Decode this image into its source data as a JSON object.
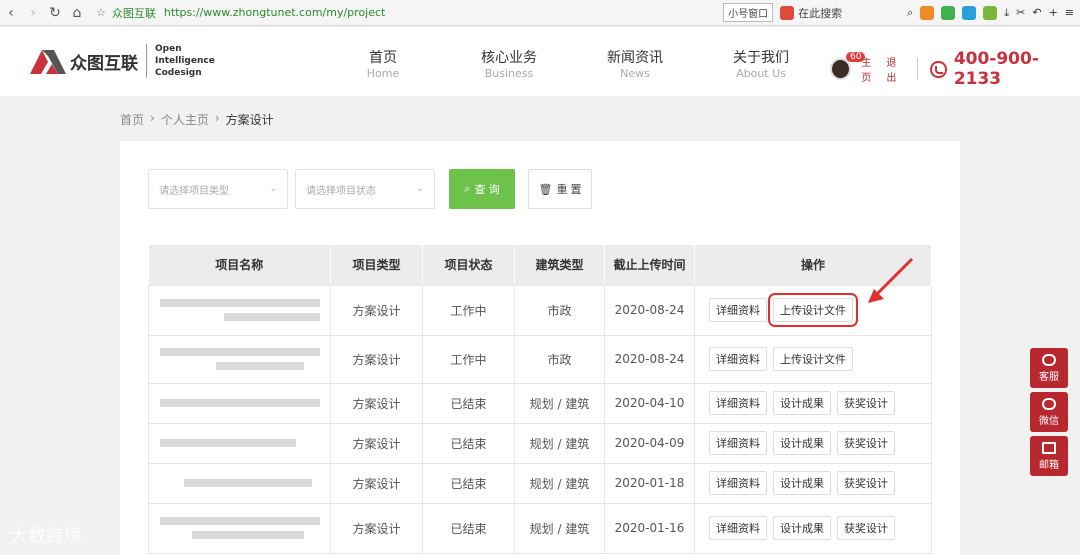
{
  "browser": {
    "site_name": "众图互联",
    "url": "https://www.zhongtunet.com/my/project",
    "small_window": "小号窗口",
    "search_placeholder": "在此搜索"
  },
  "header": {
    "logo_cn": "众图互联",
    "logo_en_1": "Open",
    "logo_en_2": "Intelligence",
    "logo_en_3": "Codesign",
    "nav": [
      {
        "cn": "首页",
        "en": "Home"
      },
      {
        "cn": "核心业务",
        "en": "Business"
      },
      {
        "cn": "新闻资讯",
        "en": "News"
      },
      {
        "cn": "关于我们",
        "en": "About Us"
      }
    ],
    "badge_count": "60",
    "home_link": "主页",
    "logout_link": "退出",
    "phone": "400-900-2133"
  },
  "breadcrumb": {
    "home": "首页",
    "personal": "个人主页",
    "current": "方案设计"
  },
  "filters": {
    "type_placeholder": "请选择项目类型",
    "status_placeholder": "请选择项目状态",
    "search_label": "查 询",
    "reset_label": "重 置"
  },
  "table": {
    "headers": [
      "项目名称",
      "项目类型",
      "项目状态",
      "建筑类型",
      "截止上传时间",
      "操作"
    ],
    "rows": [
      {
        "type": "方案设计",
        "status": "工作中",
        "building": "市政",
        "deadline": "2020-08-24",
        "ops": [
          "详细资料",
          "上传设计文件"
        ]
      },
      {
        "type": "方案设计",
        "status": "工作中",
        "building": "市政",
        "deadline": "2020-08-24",
        "ops": [
          "详细资料",
          "上传设计文件"
        ]
      },
      {
        "type": "方案设计",
        "status": "已结束",
        "building": "规划 / 建筑",
        "deadline": "2020-04-10",
        "ops": [
          "详细资料",
          "设计成果",
          "获奖设计"
        ]
      },
      {
        "type": "方案设计",
        "status": "已结束",
        "building": "规划 / 建筑",
        "deadline": "2020-04-09",
        "ops": [
          "详细资料",
          "设计成果",
          "获奖设计"
        ]
      },
      {
        "type": "方案设计",
        "status": "已结束",
        "building": "规划 / 建筑",
        "deadline": "2020-01-18",
        "ops": [
          "详细资料",
          "设计成果",
          "获奖设计"
        ]
      },
      {
        "type": "方案设计",
        "status": "已结束",
        "building": "规划 / 建筑",
        "deadline": "2020-01-16",
        "ops": [
          "详细资料",
          "设计成果",
          "获奖设计"
        ]
      }
    ]
  },
  "side": {
    "service": "客服",
    "wechat": "微信",
    "mail": "邮箱"
  },
  "watermark": "大数跨境",
  "colors": {
    "accent_red": "#c8323c",
    "search_green": "#6cc24a",
    "side_red": "#b8292f"
  }
}
